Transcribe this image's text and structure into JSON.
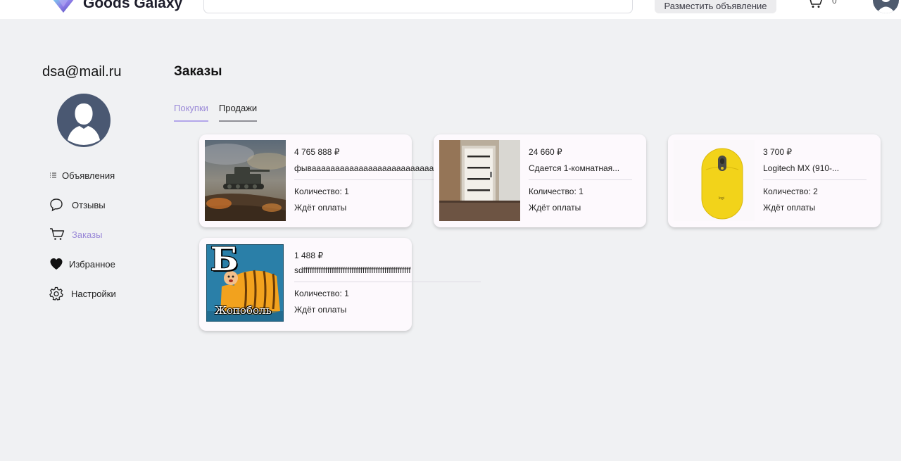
{
  "header": {
    "logo_text": "Goods Galaxy",
    "search_placeholder": "",
    "post_button_label": "Разместить объявление",
    "cart_count": "0"
  },
  "sidebar": {
    "email": "dsa@mail.ru",
    "items": [
      {
        "label": "Объявления",
        "icon": "list-icon"
      },
      {
        "label": "Отзывы",
        "icon": "chat-bubble-icon"
      },
      {
        "label": "Заказы",
        "icon": "cart-icon",
        "active": true
      },
      {
        "label": "Избранное",
        "icon": "heart-icon"
      },
      {
        "label": "Настройки",
        "icon": "gear-icon"
      }
    ]
  },
  "main": {
    "title": "Заказы",
    "tabs": [
      {
        "label": "Покупки",
        "active": true
      },
      {
        "label": "Продажи",
        "active": false
      }
    ],
    "orders": [
      {
        "price": "4 765 888 ₽",
        "title": "фываааааааааааааааааааааааааааа",
        "quantity": "Количество: 1",
        "status": "Ждёт оплаты",
        "image": "tank-battle-image"
      },
      {
        "price": "24 660 ₽",
        "title": "Сдается 1-комнатная...",
        "quantity": "Количество: 1",
        "status": "Ждёт оплаты",
        "image": "apartment-door-image"
      },
      {
        "price": "3 700 ₽",
        "title": "Logitech MX (910-...",
        "quantity": "Количество: 2",
        "status": "Ждёт оплаты",
        "image": "yellow-mouse-image"
      },
      {
        "price": "1 488 ₽",
        "title": "sdfffffffffffffffffffffffffffffffffffffffffffffffff",
        "quantity": "Количество: 1",
        "status": "Ждёт оплаты",
        "image": "meme-image",
        "image_text_top": "Б",
        "image_text_bottom": "Жопоболь"
      }
    ]
  },
  "colors": {
    "accent": "#9b8ad8",
    "background": "#f0f1f3",
    "card": "#fdf9fd",
    "avatar": "#4a5872"
  }
}
